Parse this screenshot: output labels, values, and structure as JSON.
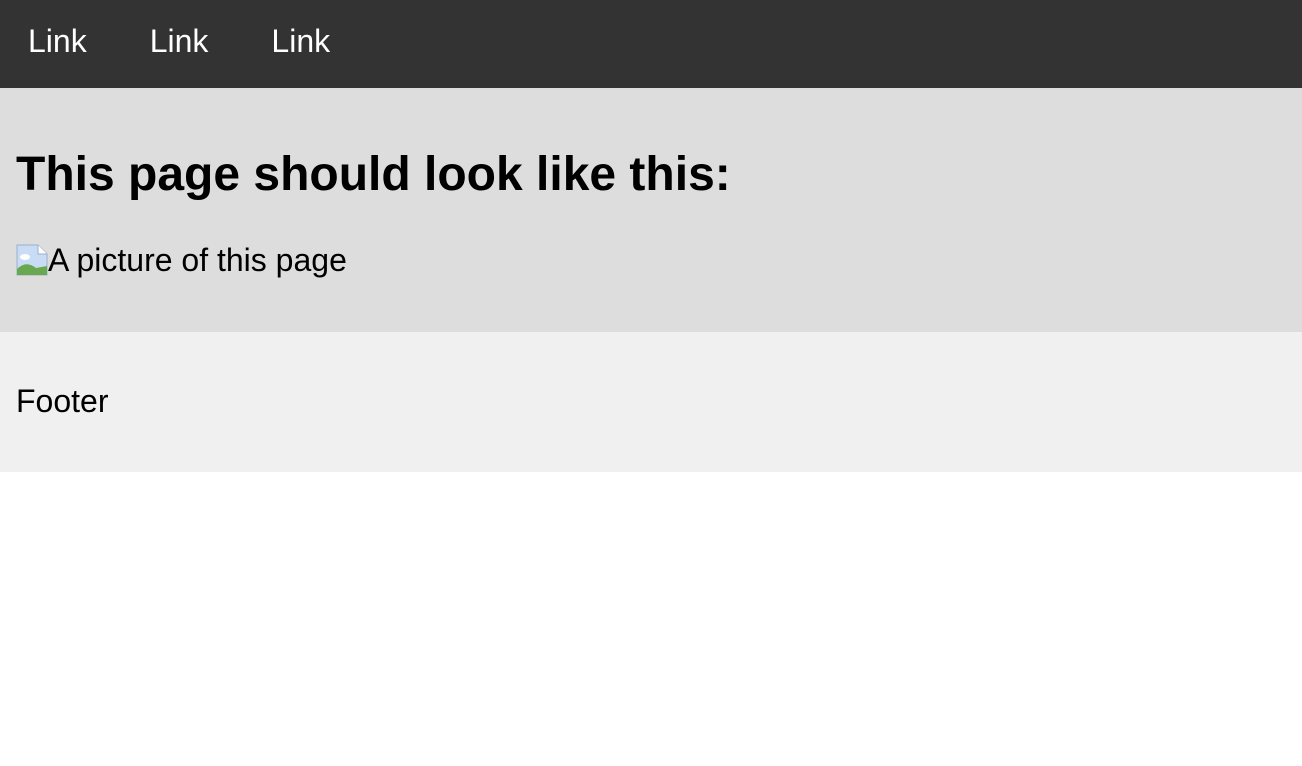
{
  "nav": {
    "links": [
      {
        "label": "Link"
      },
      {
        "label": "Link"
      },
      {
        "label": "Link"
      }
    ]
  },
  "main": {
    "heading": "This page should look like this:",
    "image_alt": "A picture of this page",
    "image_icon": "broken-image-icon"
  },
  "footer": {
    "text": "Footer"
  },
  "colors": {
    "nav_bg": "#333333",
    "nav_text": "#ffffff",
    "main_bg": "#dddddd",
    "footer_bg": "#f0f0f0",
    "body_bg": "#ffffff"
  }
}
